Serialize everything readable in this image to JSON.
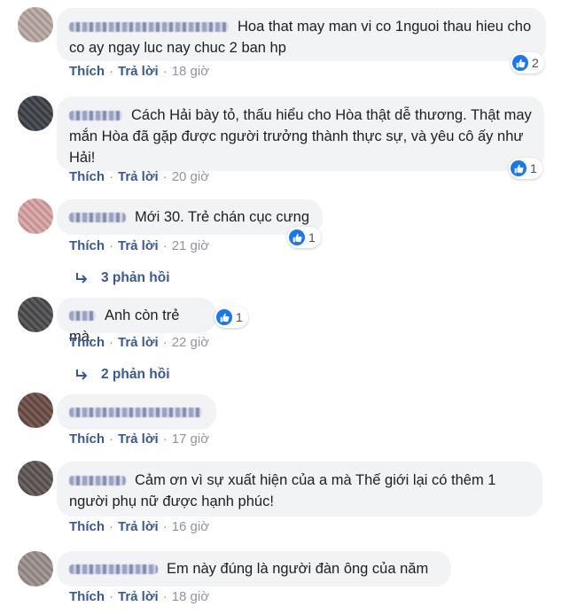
{
  "labels": {
    "like": "Thích",
    "reply": "Trả lời",
    "separator": "·"
  },
  "colors": {
    "link": "#385898",
    "meta": "#90949c",
    "bubble": "#f2f3f5",
    "like_blue": "#1877f2"
  },
  "comments": [
    {
      "text": "Hoa that may man vi co 1nguoi thau hieu cho co ay ngay luc nay chuc 2 ban hp",
      "reactions": "2",
      "time": "18 giờ",
      "avatar_color": "#b9a7a3"
    },
    {
      "text": "Cách Hải bày tỏ, thấu hiểu cho Hòa thật dễ thương. Thật may mắn Hòa đã gặp được người trưởng thành thực sự, và yêu cô ấy như Hải!",
      "reactions": "1",
      "time": "20 giờ",
      "avatar_color": "#3d4148"
    },
    {
      "text": "Mới 30. Trẻ chán cục cưng",
      "reactions": "1",
      "time": "21 giờ",
      "avatar_color": "#d8a3a3",
      "replies": "3 phản hồi"
    },
    {
      "text": "Anh còn trẻ mà.",
      "reactions": "1",
      "time": "22 giờ",
      "avatar_color": "#4c4b4d",
      "replies": "2 phản hồi"
    },
    {
      "text": "",
      "time": "17 giờ",
      "avatar_color": "#6a4d45"
    },
    {
      "text": "Cảm ơn vì sự xuất hiện của a mà Thế giới lại có thêm 1 người phụ nữ được hạnh phúc!",
      "time": "16 giờ",
      "avatar_color": "#5d5552"
    },
    {
      "text": "Em này đúng là người đàn ông của năm",
      "time": "18 giờ",
      "avatar_color": "#9a8f8c"
    }
  ]
}
